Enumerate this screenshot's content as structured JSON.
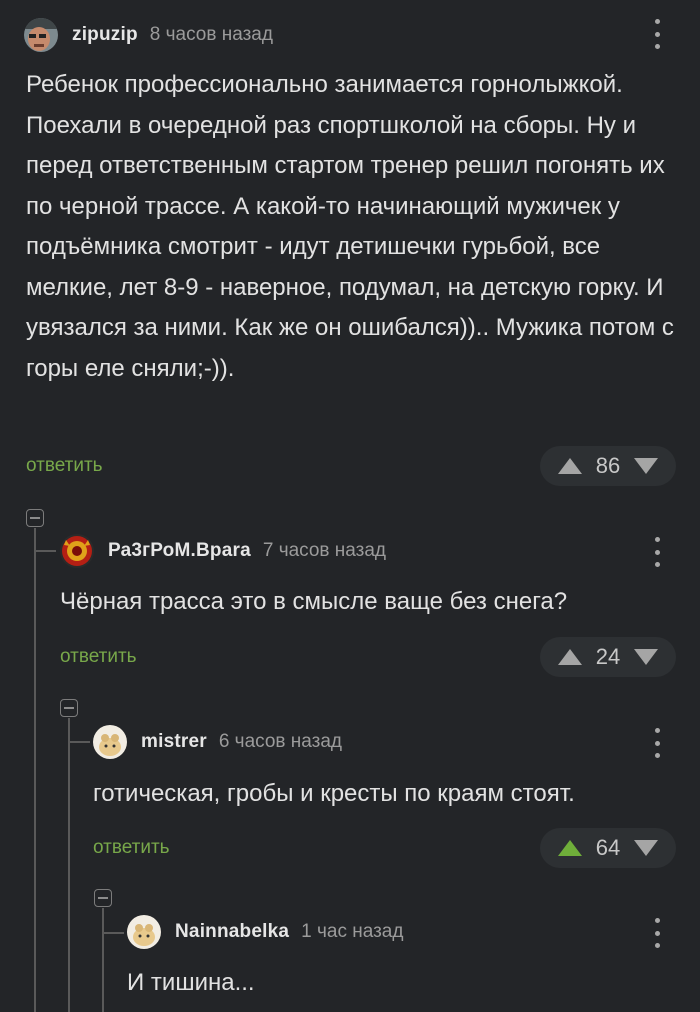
{
  "comments": [
    {
      "username": "zipuzip",
      "time": "8 часов назад",
      "text": "Ребенок профессионально занимается горнолыжкой. Поехали в очередной раз спортшколой на сборы. Ну и перед ответственным стартом тренер решил погонять их по черной трассе. А какой-то начинающий мужичек у подъёмника смотрит - идут детишечки гурьбой, все мелкие, лет 8-9 - наверное, подумал, на детскую горку. И увязался за ними. Как же он ошибался)).. Мужика потом с горы еле сняли;-)).",
      "reply_label": "ответить",
      "rating": "86"
    },
    {
      "username": "Ра3гРоМ.Враrа",
      "time": "7 часов назад",
      "text": "Чёрная трасса это в смысле ваще без снега?",
      "reply_label": "ответить",
      "rating": "24"
    },
    {
      "username": "mistrer",
      "time": "6 часов назад",
      "text": "готическая, гробы и кресты по краям стоят.",
      "reply_label": "ответить",
      "rating": "64"
    },
    {
      "username": "Nainnabelka",
      "time": "1 час назад",
      "text": "И тишина..."
    }
  ],
  "colors": {
    "background": "#232528",
    "reply": "#78a84a",
    "upvote_active": "#6fae3a"
  }
}
